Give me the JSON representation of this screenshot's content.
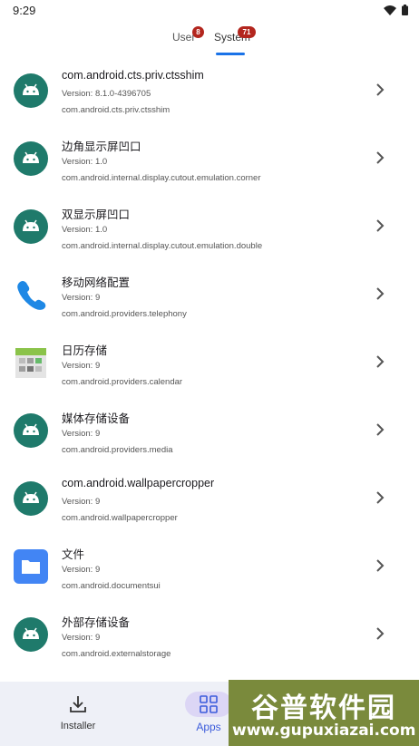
{
  "status_bar": {
    "time": "9:29"
  },
  "tabs": {
    "user": {
      "label": "User",
      "badge": "8"
    },
    "system": {
      "label": "System",
      "badge": "71"
    }
  },
  "apps": [
    {
      "name": "com.android.cts.priv.ctsshim",
      "version": "Version: 8.1.0-4396705",
      "package": "com.android.cts.priv.ctsshim",
      "icon": "android-icon"
    },
    {
      "name": "边角显示屏凹口",
      "version": "Version: 1.0",
      "package": "com.android.internal.display.cutout.emulation.corner",
      "icon": "android-icon"
    },
    {
      "name": "双显示屏凹口",
      "version": "Version: 1.0",
      "package": "com.android.internal.display.cutout.emulation.double",
      "icon": "android-icon"
    },
    {
      "name": "移动网络配置",
      "version": "Version: 9",
      "package": "com.android.providers.telephony",
      "icon": "phone-icon"
    },
    {
      "name": "日历存储",
      "version": "Version: 9",
      "package": "com.android.providers.calendar",
      "icon": "calendar-icon"
    },
    {
      "name": "媒体存储设备",
      "version": "Version: 9",
      "package": "com.android.providers.media",
      "icon": "android-icon"
    },
    {
      "name": "com.android.wallpapercropper",
      "version": "Version: 9",
      "package": "com.android.wallpapercropper",
      "icon": "android-icon"
    },
    {
      "name": "文件",
      "version": "Version: 9",
      "package": "com.android.documentsui",
      "icon": "folder-icon"
    },
    {
      "name": "外部存储设备",
      "version": "Version: 9",
      "package": "com.android.externalstorage",
      "icon": "android-icon"
    }
  ],
  "bottom_nav": {
    "installer": {
      "label": "Installer",
      "icon": "download-icon"
    },
    "apps": {
      "label": "Apps",
      "icon": "grid-icon"
    }
  },
  "watermark": {
    "top": "谷普软件园",
    "bottom": "www.gupuxiazai.com"
  },
  "colors": {
    "android_teal": "#1f7a6b",
    "accent": "#1a73e8",
    "badge": "#b3261e",
    "nav_bg": "#eef0f7"
  }
}
